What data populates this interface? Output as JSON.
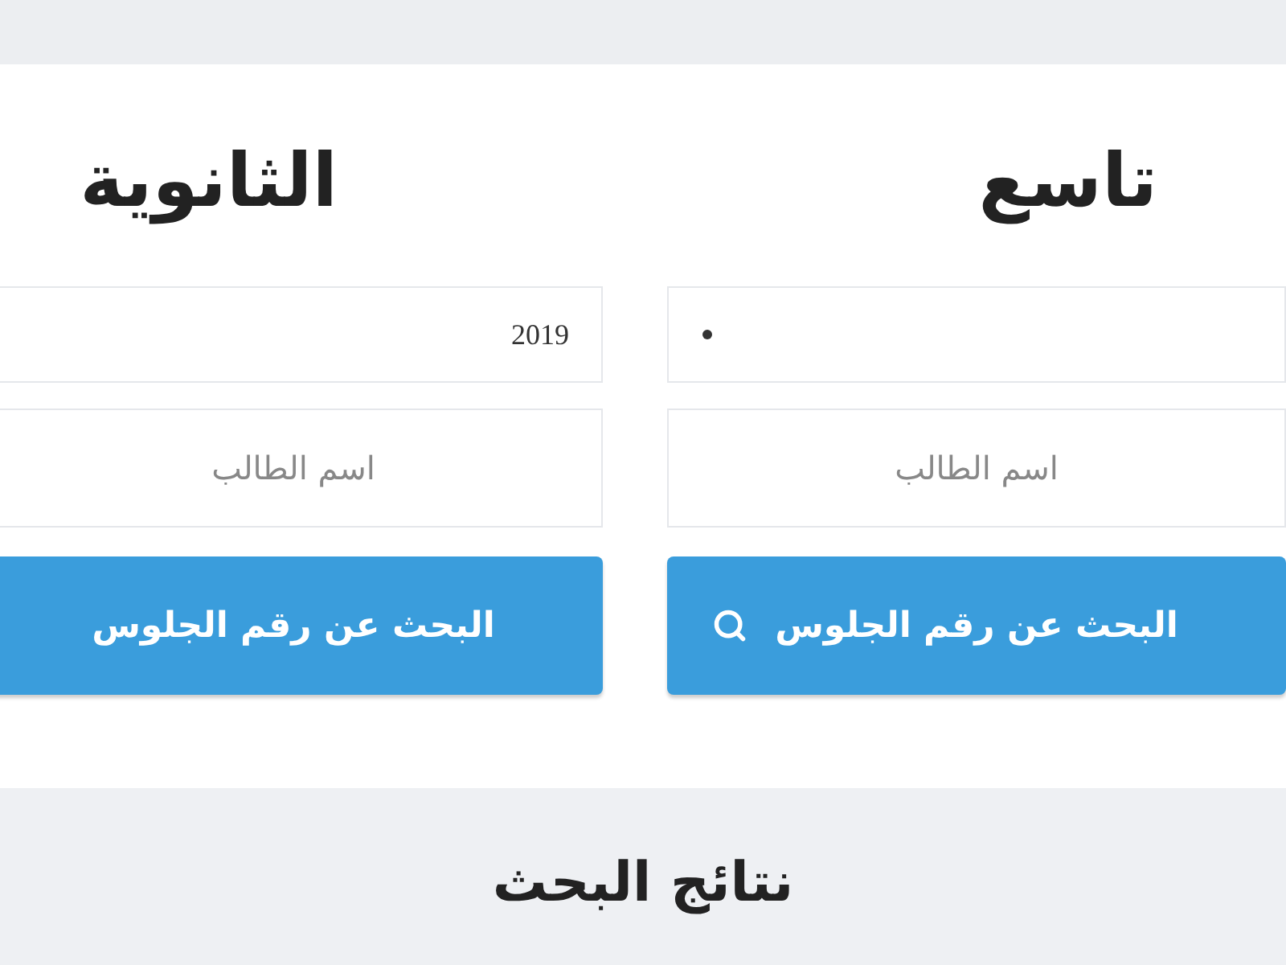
{
  "forms": [
    {
      "title": "تاسع",
      "year_select": {
        "caret": true
      },
      "name_field": {
        "placeholder": "اسم الطالب"
      },
      "search_button": {
        "label": "البحث عن رقم الجلوس",
        "icon": true
      }
    },
    {
      "title": "الثانوية",
      "year_select": {
        "value": "2019",
        "caret": false
      },
      "name_field": {
        "placeholder": "اسم الطالب"
      },
      "search_button": {
        "label": "البحث عن رقم الجلوس",
        "icon": false
      }
    }
  ],
  "results": {
    "heading": "نتائج البحث"
  }
}
